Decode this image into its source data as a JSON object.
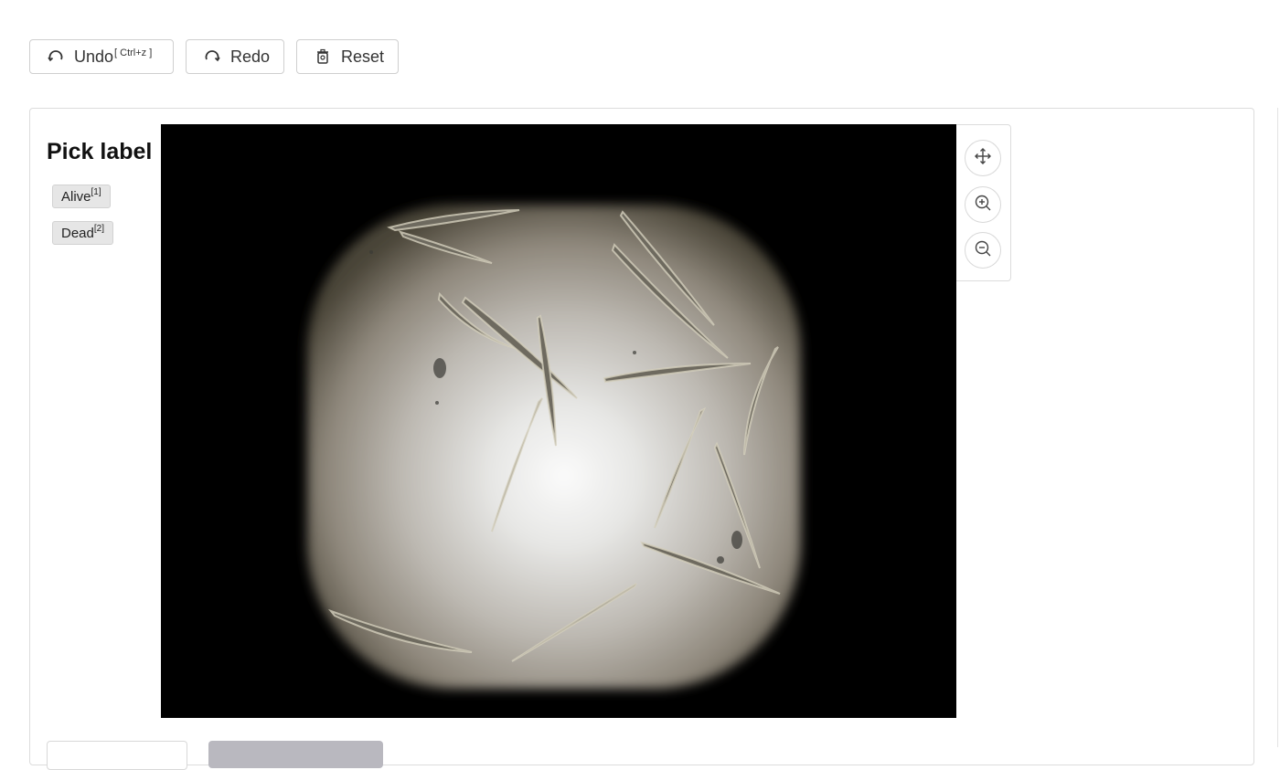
{
  "toolbar": {
    "undo_label": "Undo",
    "undo_shortcut": "[ Ctrl+z ]",
    "redo_label": "Redo",
    "reset_label": "Reset"
  },
  "labels_panel": {
    "title": "Pick label",
    "items": [
      {
        "label": "Alive",
        "shortcut": "[1]"
      },
      {
        "label": "Dead",
        "shortcut": "[2]"
      }
    ]
  },
  "canvas": {
    "image_description_icon": "microscope-image",
    "colors": {
      "background": "#000000",
      "outline": "#c8c3b0"
    }
  },
  "tools": {
    "move_icon": "move-icon",
    "zoom_in_icon": "zoom-in-icon",
    "zoom_out_icon": "zoom-out-icon"
  }
}
